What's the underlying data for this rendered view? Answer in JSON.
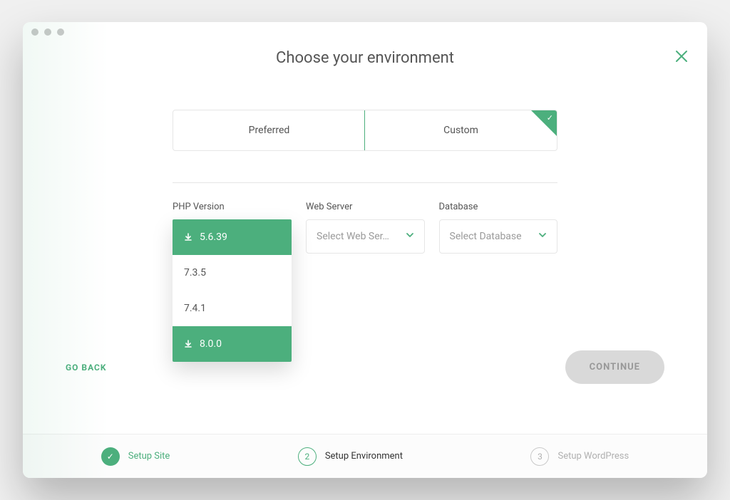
{
  "header": {
    "title": "Choose your environment"
  },
  "tabs": {
    "preferred": "Preferred",
    "custom": "Custom",
    "selected": "Custom"
  },
  "fields": {
    "php": {
      "label": "PHP Version",
      "options": [
        {
          "label": "5.6.39",
          "download": true,
          "highlight": true
        },
        {
          "label": "7.3.5",
          "download": false,
          "highlight": false
        },
        {
          "label": "7.4.1",
          "download": false,
          "highlight": false
        },
        {
          "label": "8.0.0",
          "download": true,
          "highlight": true
        }
      ]
    },
    "webserver": {
      "label": "Web Server",
      "placeholder": "Select Web Ser…"
    },
    "database": {
      "label": "Database",
      "placeholder": "Select Database"
    }
  },
  "footer": {
    "back": "GO BACK",
    "continue": "CONTINUE"
  },
  "steps": [
    {
      "num": "✓",
      "label": "Setup Site",
      "state": "done"
    },
    {
      "num": "2",
      "label": "Setup Environment",
      "state": "active"
    },
    {
      "num": "3",
      "label": "Setup WordPress",
      "state": "pending"
    }
  ]
}
